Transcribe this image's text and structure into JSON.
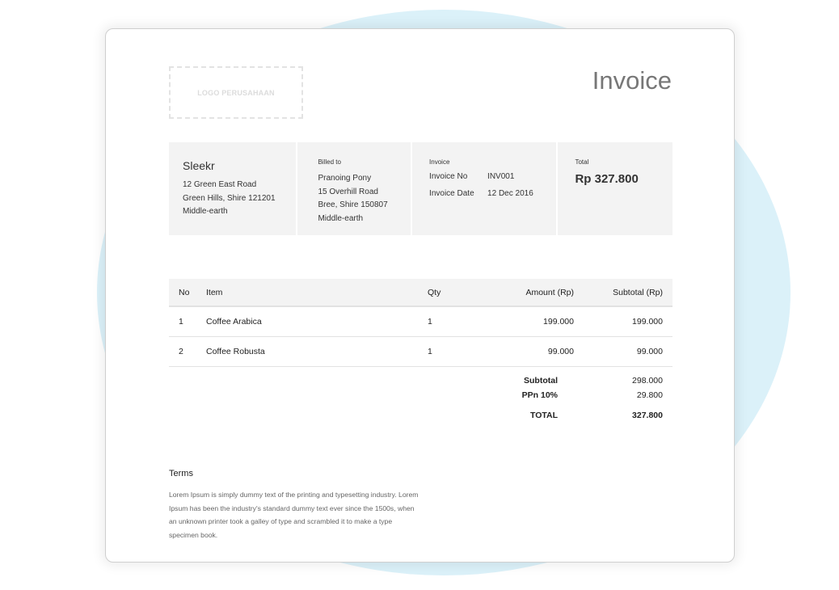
{
  "logo": {
    "text": "LOGO PERUSAHAAN"
  },
  "title": "Invoice",
  "company": {
    "name": "Sleekr",
    "address": [
      "12 Green East Road",
      "Green Hills, Shire 121201",
      "Middle-earth"
    ]
  },
  "billed_to": {
    "heading": "Billed to",
    "lines": [
      "Pranoing Pony",
      "15 Overhill Road",
      "Bree, Shire 150807",
      "Middle-earth"
    ]
  },
  "invoice_info": {
    "heading": "Invoice",
    "no_label": "Invoice No",
    "no_value": "INV001",
    "date_label": "Invoice Date",
    "date_value": "12 Dec 2016"
  },
  "total_box": {
    "heading": "Total",
    "value": "Rp 327.800"
  },
  "table": {
    "headers": {
      "no": "No",
      "item": "Item",
      "qty": "Qty",
      "amount": "Amount (Rp)",
      "subtotal": "Subtotal (Rp)"
    },
    "rows": [
      {
        "no": "1",
        "item": "Coffee Arabica",
        "qty": "1",
        "amount": "199.000",
        "subtotal": "199.000"
      },
      {
        "no": "2",
        "item": "Coffee Robusta",
        "qty": "1",
        "amount": "99.000",
        "subtotal": "99.000"
      }
    ]
  },
  "summary": {
    "subtotal_label": "Subtotal",
    "subtotal_value": "298.000",
    "tax_label": "PPn 10%",
    "tax_value": "29.800",
    "total_label": "TOTAL",
    "total_value": "327.800"
  },
  "terms": {
    "heading": "Terms",
    "body": "Lorem Ipsum is simply dummy text of the printing and typesetting industry. Lorem Ipsum has been the industry's standard dummy text ever since the 1500s, when an unknown printer took a galley of type and scrambled it to make a type specimen book."
  },
  "colors": {
    "background_blob": "#dbf1f9",
    "panel_gray": "#f3f3f3",
    "title_gray": "#777777"
  }
}
